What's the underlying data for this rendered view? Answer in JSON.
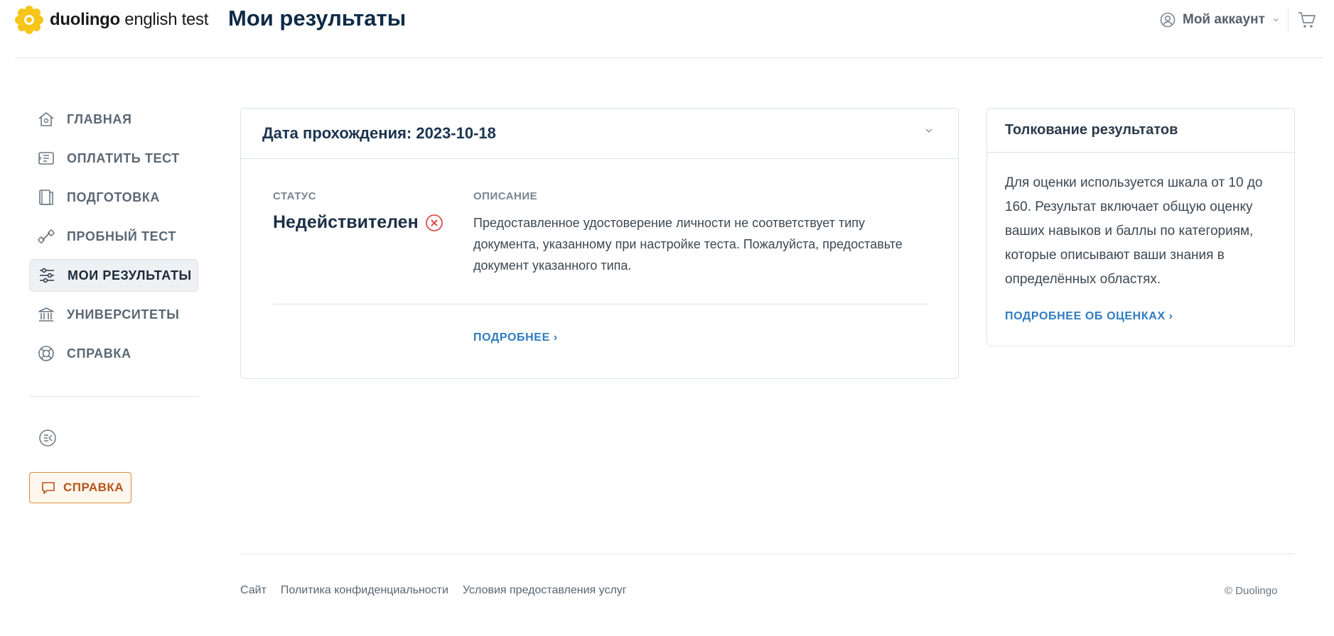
{
  "header": {
    "logo_brand": "duolingo",
    "logo_suffix": "english test",
    "page_title": "Мои результаты",
    "account_label": "Мой аккаунт",
    "account_icon": "user-circle-icon",
    "cart_icon": "cart-icon"
  },
  "sidebar": {
    "items": [
      {
        "label": "ГЛАВНАЯ",
        "icon": "home-icon",
        "active": false
      },
      {
        "label": "ОПЛАТИТЬ ТЕСТ",
        "icon": "ticket-icon",
        "active": false
      },
      {
        "label": "ПОДГОТОВКА",
        "icon": "book-icon",
        "active": false
      },
      {
        "label": "ПРОБНЫЙ ТЕСТ",
        "icon": "dumbbell-icon",
        "active": false
      },
      {
        "label": "МОИ РЕЗУЛЬТАТЫ",
        "icon": "sliders-icon",
        "active": true
      },
      {
        "label": "УНИВЕРСИТЕТЫ",
        "icon": "university-icon",
        "active": false
      },
      {
        "label": "СПРАВКА",
        "icon": "lifebuoy-icon",
        "active": false
      }
    ],
    "collapse_icon": "collapse-menu-icon",
    "help_button_label": "СПРАВКА",
    "help_button_icon": "chat-bubble-icon"
  },
  "result_card": {
    "title": "Дата прохождения: 2023-10-18",
    "status_heading": "СТАТУС",
    "status_value": "Недействителен",
    "status_icon": "x-circle-icon",
    "status_color": "#e04b4b",
    "description_heading": "ОПИСАНИЕ",
    "description": "Предоставленное удостоверение личности не соответствует типу документа, указанному при настройке теста. Пожалуйста, предоставьте документ указанного типа.",
    "more_link": "ПОДРОБНЕЕ ›"
  },
  "interpretation_card": {
    "title": "Толкование результатов",
    "body": "Для оценки используется шкала от 10 до 160. Результат включает общую оценку ваших навыков и баллы по категориям, которые описывают ваши знания в определённых областях.",
    "link": "ПОДРОБНЕЕ ОБ ОЦЕНКАХ ›"
  },
  "footer": {
    "links": [
      "Сайт",
      "Политика конфиденциальности",
      "Условия предоставления услуг"
    ],
    "copyright": "© Duolingo"
  },
  "colors": {
    "accent_blue": "#2f7cc0",
    "title_navy": "#0e2a47",
    "help_orange": "#b5541a",
    "logo_yellow": "#f5c518"
  }
}
